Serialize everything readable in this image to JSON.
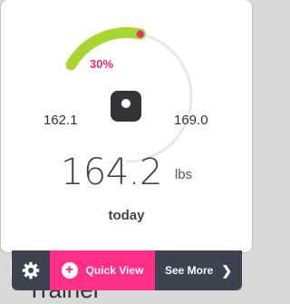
{
  "gauge": {
    "percent_label": "30%",
    "start_value": "162.1",
    "end_value": "169.0",
    "progress": 0.3,
    "progress_color": "#a8d630",
    "track_color": "#e8e8e8",
    "marker_color": "#e0306e"
  },
  "reading": {
    "weight": "164.2",
    "unit": "lbs",
    "date": "today"
  },
  "icons": {
    "scale": "scale-icon",
    "settings": "gear-icon",
    "quick_view": "plus-circle-icon",
    "see_more": "chevron-right-icon"
  },
  "actions": {
    "quick_view_label": "Quick View",
    "see_more_label": "See More"
  },
  "background": {
    "partial_text": "Trainer"
  },
  "colors": {
    "accent": "#ff2e86",
    "bar_dark": "#3d4450"
  }
}
